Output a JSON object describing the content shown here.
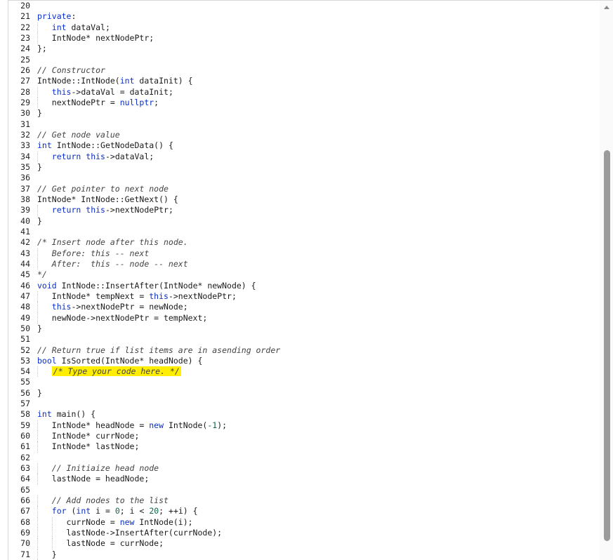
{
  "editor": {
    "lines": [
      {
        "n": "20",
        "t": ""
      },
      {
        "n": "21",
        "t": "private:"
      },
      {
        "n": "22",
        "t": "   int dataVal;"
      },
      {
        "n": "23",
        "t": "   IntNode* nextNodePtr;"
      },
      {
        "n": "24",
        "t": "};"
      },
      {
        "n": "25",
        "t": ""
      },
      {
        "n": "26",
        "t": "// Constructor"
      },
      {
        "n": "27",
        "t": "IntNode::IntNode(int dataInit) {"
      },
      {
        "n": "28",
        "t": "   this->dataVal = dataInit;"
      },
      {
        "n": "29",
        "t": "   nextNodePtr = nullptr;"
      },
      {
        "n": "30",
        "t": "}"
      },
      {
        "n": "31",
        "t": ""
      },
      {
        "n": "32",
        "t": "// Get node value"
      },
      {
        "n": "33",
        "t": "int IntNode::GetNodeData() {"
      },
      {
        "n": "34",
        "t": "   return this->dataVal;"
      },
      {
        "n": "35",
        "t": "}"
      },
      {
        "n": "36",
        "t": ""
      },
      {
        "n": "37",
        "t": "// Get pointer to next node"
      },
      {
        "n": "38",
        "t": "IntNode* IntNode::GetNext() {"
      },
      {
        "n": "39",
        "t": "   return this->nextNodePtr;"
      },
      {
        "n": "40",
        "t": "}"
      },
      {
        "n": "41",
        "t": ""
      },
      {
        "n": "42",
        "t": "/* Insert node after this node."
      },
      {
        "n": "43",
        "t": "   Before: this -- next"
      },
      {
        "n": "44",
        "t": "   After:  this -- node -- next"
      },
      {
        "n": "45",
        "t": "*/"
      },
      {
        "n": "46",
        "t": "void IntNode::InsertAfter(IntNode* newNode) {"
      },
      {
        "n": "47",
        "t": "   IntNode* tempNext = this->nextNodePtr;"
      },
      {
        "n": "48",
        "t": "   this->nextNodePtr = newNode;"
      },
      {
        "n": "49",
        "t": "   newNode->nextNodePtr = tempNext;"
      },
      {
        "n": "50",
        "t": "}"
      },
      {
        "n": "51",
        "t": ""
      },
      {
        "n": "52",
        "t": "// Return true if list items are in asending order"
      },
      {
        "n": "53",
        "t": "bool IsSorted(IntNode* headNode) {"
      },
      {
        "n": "54",
        "t": "   /* Type your code here. */"
      },
      {
        "n": "55",
        "t": ""
      },
      {
        "n": "56",
        "t": "}"
      },
      {
        "n": "57",
        "t": ""
      },
      {
        "n": "58",
        "t": "int main() {"
      },
      {
        "n": "59",
        "t": "   IntNode* headNode = new IntNode(-1);"
      },
      {
        "n": "60",
        "t": "   IntNode* currNode;"
      },
      {
        "n": "61",
        "t": "   IntNode* lastNode;"
      },
      {
        "n": "62",
        "t": ""
      },
      {
        "n": "63",
        "t": "   // Initiaize head node"
      },
      {
        "n": "64",
        "t": "   lastNode = headNode;"
      },
      {
        "n": "65",
        "t": ""
      },
      {
        "n": "66",
        "t": "   // Add nodes to the list"
      },
      {
        "n": "67",
        "t": "   for (int i = 0; i < 20; ++i) {"
      },
      {
        "n": "68",
        "t": "      currNode = new IntNode(i);"
      },
      {
        "n": "69",
        "t": "      lastNode->InsertAfter(currNode);"
      },
      {
        "n": "70",
        "t": "      lastNode = currNode;"
      },
      {
        "n": "71",
        "t": "   }"
      }
    ],
    "highlighted_line": "54"
  },
  "scrollbar": {
    "up_icon": "arrow-up-icon"
  },
  "colors": {
    "keyword": "#0a2ec7",
    "comment": "#444444",
    "number": "#116644",
    "highlight": "#ffee00"
  }
}
